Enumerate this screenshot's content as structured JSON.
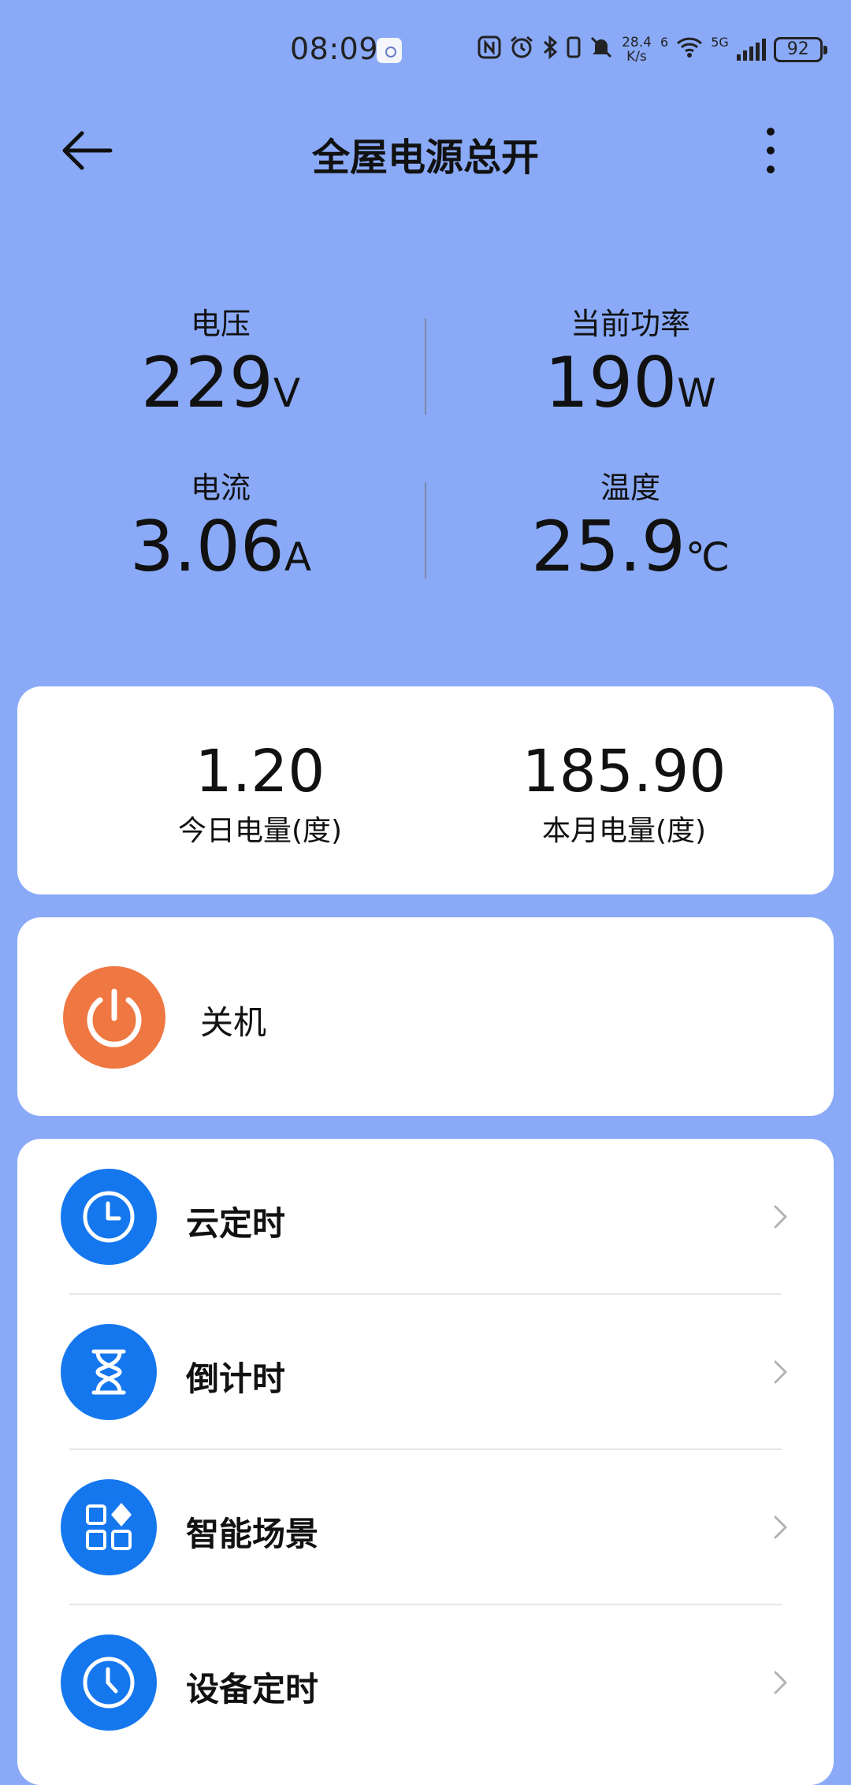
{
  "status_bar": {
    "time": "08:09",
    "net_speed_value": "28.4",
    "net_speed_unit": "K/s",
    "wifi_level": "6",
    "cellular": "5G",
    "battery": "92",
    "icons": [
      "nfc-icon",
      "alarm-icon",
      "bluetooth-icon",
      "vibrate-icon",
      "mute-icon",
      "wifi-icon",
      "signal-icon",
      "battery-icon"
    ]
  },
  "header": {
    "title": "全屋电源总开",
    "back_icon": "arrow-left-icon",
    "more_icon": "more-vertical-icon"
  },
  "metrics": {
    "voltage": {
      "label": "电压",
      "value": "229",
      "unit": "V"
    },
    "power": {
      "label": "当前功率",
      "value": "190",
      "unit": "W"
    },
    "current": {
      "label": "电流",
      "value": "3.06",
      "unit": "A"
    },
    "temperature": {
      "label": "温度",
      "value": "25.9",
      "unit": "℃"
    }
  },
  "energy": {
    "today": {
      "value": "1.20",
      "label": "今日电量(度)"
    },
    "month": {
      "value": "185.90",
      "label": "本月电量(度)"
    }
  },
  "power_switch": {
    "label": "关机",
    "icon": "power-icon",
    "color": "#ef7741"
  },
  "menu": {
    "items": [
      {
        "label": "云定时",
        "icon": "clock-icon"
      },
      {
        "label": "倒计时",
        "icon": "hourglass-icon"
      },
      {
        "label": "智能场景",
        "icon": "scene-grid-icon"
      },
      {
        "label": "设备定时",
        "icon": "clock-icon"
      }
    ],
    "accent_color": "#1577ee"
  },
  "colors": {
    "background": "#8aaaf8",
    "card": "#ffffff"
  }
}
